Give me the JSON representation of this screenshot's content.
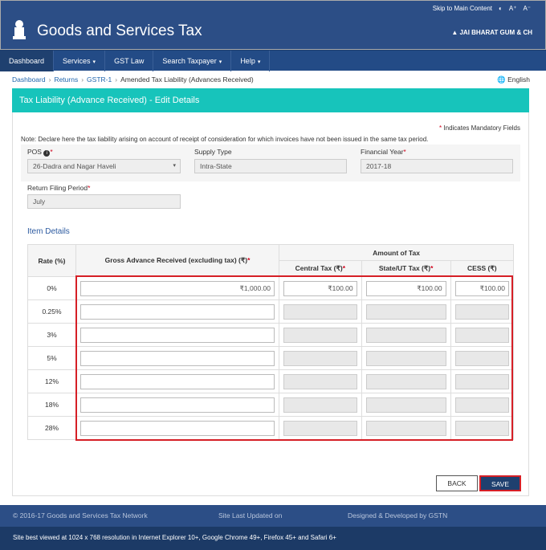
{
  "util": {
    "skip": "Skip to Main Content",
    "contrast": "◐",
    "font_up": "A⁺",
    "font_down": "A⁻"
  },
  "brand": {
    "title": "Goods and Services Tax",
    "user": "JAI BHARAT GUM & CH"
  },
  "nav": [
    {
      "label": "Dashboard",
      "caret": false
    },
    {
      "label": "Services",
      "caret": true
    },
    {
      "label": "GST Law",
      "caret": false
    },
    {
      "label": "Search Taxpayer",
      "caret": true
    },
    {
      "label": "Help",
      "caret": true
    }
  ],
  "breadcrumb": {
    "items": [
      "Dashboard",
      "Returns",
      "GSTR-1"
    ],
    "current": "Amended Tax Liability (Advances Received)",
    "language": "English"
  },
  "page": {
    "heading": "Tax Liability (Advance Received) - Edit Details",
    "mandatory": "Indicates Mandatory Fields",
    "note": "Note: Declare here the tax liability arising on account of receipt of consideration for which invoices have not been issued in the same tax period."
  },
  "form": {
    "pos_label": "POS",
    "pos_value": "26-Dadra and Nagar Haveli",
    "supply_label": "Supply Type",
    "supply_value": "Intra-State",
    "fy_label": "Financial Year",
    "fy_value": "2017-18",
    "period_label": "Return Filing Period",
    "period_value": "July"
  },
  "items": {
    "title": "Item Details",
    "headers": {
      "rate": "Rate (%)",
      "gross": "Gross Advance Received (excluding tax) (₹)",
      "amount": "Amount of Tax",
      "central": "Central Tax (₹)",
      "state": "State/UT Tax (₹)",
      "cess": "CESS (₹)"
    },
    "rows": [
      {
        "rate": "0%",
        "gross": "₹1,000.00",
        "central": "₹100.00",
        "state": "₹100.00",
        "cess": "₹100.00"
      },
      {
        "rate": "0.25%",
        "gross": "",
        "central": "",
        "state": "",
        "cess": ""
      },
      {
        "rate": "3%",
        "gross": "",
        "central": "",
        "state": "",
        "cess": ""
      },
      {
        "rate": "5%",
        "gross": "",
        "central": "",
        "state": "",
        "cess": ""
      },
      {
        "rate": "12%",
        "gross": "",
        "central": "",
        "state": "",
        "cess": ""
      },
      {
        "rate": "18%",
        "gross": "",
        "central": "",
        "state": "",
        "cess": ""
      },
      {
        "rate": "28%",
        "gross": "",
        "central": "",
        "state": "",
        "cess": ""
      }
    ]
  },
  "buttons": {
    "back": "BACK",
    "save": "SAVE"
  },
  "footer": {
    "copyright": "© 2016-17 Goods and Services Tax Network",
    "updated": "Site Last Updated on",
    "designed": "Designed & Developed by GSTN",
    "browser": "Site best viewed at 1024 x 768 resolution in Internet Explorer 10+, Google Chrome 49+, Firefox 45+ and Safari 6+"
  },
  "colors": {
    "header": "#2c4e86",
    "teal": "#17c4bb",
    "highlight": "#d61f26"
  }
}
